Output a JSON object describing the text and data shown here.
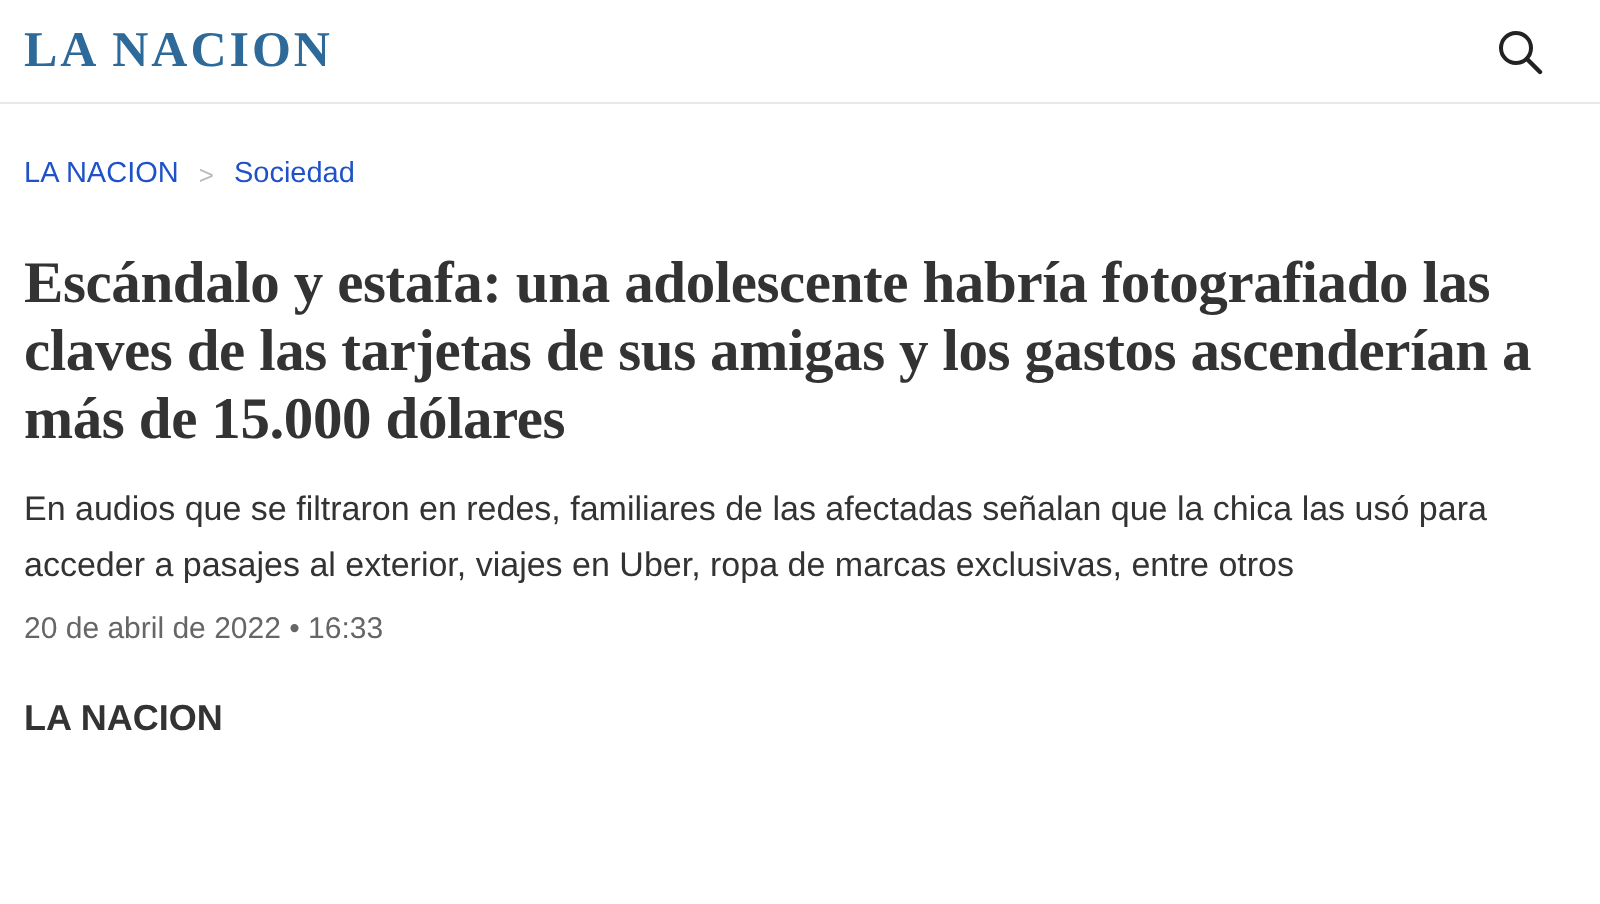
{
  "header": {
    "logo": "LA NACION"
  },
  "breadcrumb": {
    "items": [
      "LA NACION",
      "Sociedad"
    ],
    "separator": ">"
  },
  "headline": "Escándalo y estafa: una adolescente habría fotografiado las claves de las tarjetas de sus amigas y los gastos ascenderían a más de 15.000 dólares",
  "summary": "En audios que se filtraron en redes, familiares de las afectadas señalan que la chica las usó para acceder a pasajes al exterior, viajes en Uber, ropa de marcas exclusivas, entre otros",
  "date": "20 de abril de 2022 • 16:33",
  "author": "LA NACION"
}
